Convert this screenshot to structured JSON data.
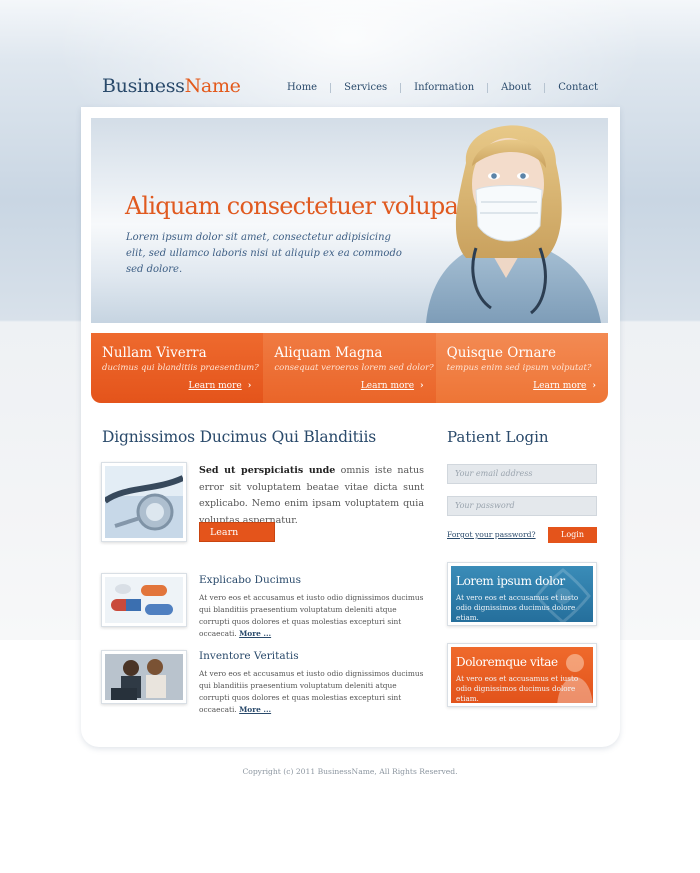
{
  "brand": {
    "name_part1": "Business",
    "name_part2": "Name"
  },
  "nav": {
    "items": [
      "Home",
      "Services",
      "Information",
      "About",
      "Contact"
    ]
  },
  "hero": {
    "title": "Aliquam consectetuer volupat",
    "text": "Lorem ipsum dolor sit amet, consectetur adipisicing elit, sed ullamco laboris nisi ut aliquip ex ea commodo sed dolore."
  },
  "tabs": [
    {
      "title": "Nullam Viverra",
      "subtitle": "ducimus qui blanditiis praesentium?",
      "link": "Learn more"
    },
    {
      "title": "Aliquam Magna",
      "subtitle": "consequat veroeros lorem sed dolor?",
      "link": "Learn more"
    },
    {
      "title": "Quisque Ornare",
      "subtitle": "tempus enim sed ipsum volputat?",
      "link": "Learn more"
    }
  ],
  "main": {
    "title": "Dignissimos Ducimus Qui Blanditiis",
    "feature": {
      "bold": "Sed ut perspiciatis unde",
      "text": " omnis iste natus error sit voluptatem beatae vitae dicta sunt explicabo. Nemo enim ipsam voluptatem quia voluptas aspernatur.",
      "button": "Learn more"
    },
    "items": [
      {
        "title": "Explicabo Ducimus",
        "text": "At vero eos et accusamus et iusto odio dignissimos ducimus qui blanditiis praesentium voluptatum deleniti atque corrupti quos dolores et quas molestias excepturi sint occaecati.",
        "more": "More ..."
      },
      {
        "title": "Inventore Veritatis",
        "text": "At vero eos et accusamus et iusto odio dignissimos ducimus qui blanditiis praesentium voluptatum deleniti atque corrupti quos dolores et quas molestias excepturi sint occaecati.",
        "more": "More ..."
      }
    ]
  },
  "login": {
    "title": "Patient Login",
    "email_placeholder": "Your email address",
    "password_placeholder": "Your password",
    "forgot": "Forgot your password?",
    "button": "Login"
  },
  "promos": [
    {
      "title": "Lorem ipsum dolor",
      "text": "At vero eos et accusamus et iusto odio dignissimos ducimus dolore etiam."
    },
    {
      "title": "Doloremque vitae",
      "text": "At vero eos et accusamus et iusto odio dignissimos ducimus dolore etiam."
    }
  ],
  "footer": {
    "copyright": "Copyright (c) 2011 BusinessName, All Rights Reserved."
  },
  "colors": {
    "accent": "#e4541b",
    "navy": "#2a4a6b",
    "blue_promo": "#2d7aa8"
  },
  "icons": {
    "tab_arrow": "chevron-right-icon"
  }
}
